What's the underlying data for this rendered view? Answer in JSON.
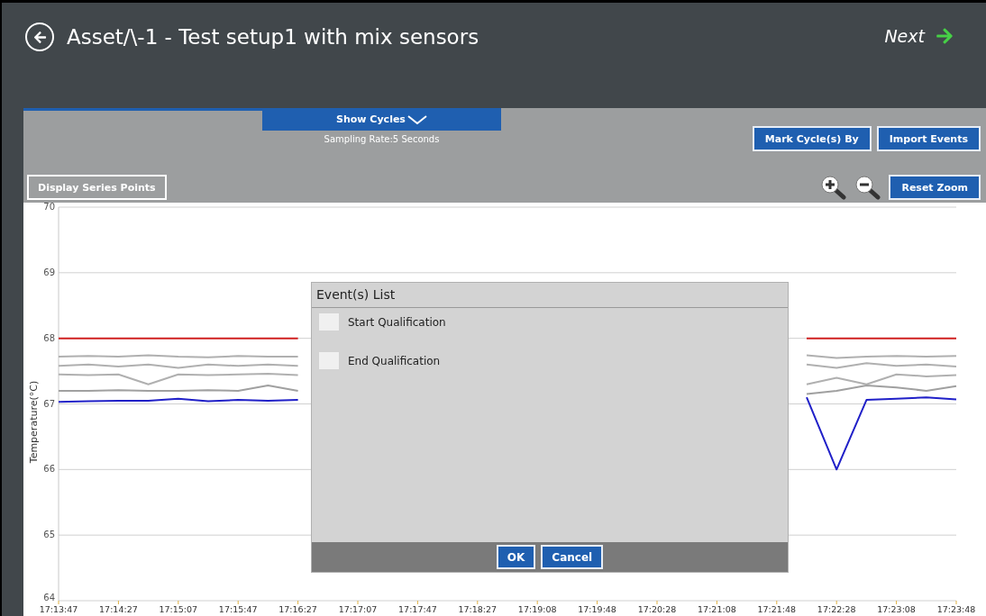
{
  "header": {
    "title": "Asset/\\-1 - Test setup1 with mix sensors",
    "next_label": "Next"
  },
  "toolbar": {
    "show_cycles": "Show Cycles",
    "sampling_rate": "Sampling Rate:5 Seconds",
    "buttons": [
      "Mark Cycle(s) By",
      "Import Events"
    ],
    "display_points": "Display Series Points",
    "reset_zoom": "Reset Zoom"
  },
  "chart": {
    "chart_data": {
      "type": "line",
      "ylabel": "Temperature(°C)",
      "categories": [
        "17:13:47",
        null,
        "17:14:27",
        null,
        "17:15:07",
        null,
        "17:15:47",
        null,
        "17:16:27",
        null,
        "17:17:07",
        null,
        "17:17:47",
        null,
        "17:18:27",
        null,
        "17:19:08",
        null,
        "17:19:48",
        null,
        "17:20:28",
        null,
        "17:21:08",
        null,
        "17:21:48",
        null,
        "17:22:28",
        null,
        "17:23:08",
        null,
        "17:23:48"
      ],
      "ylim": [
        64,
        70
      ],
      "grid": true,
      "yticks": [
        64,
        65,
        66,
        67,
        68,
        69,
        70
      ],
      "series": [
        {
          "color": "#d02020",
          "values": [
            68,
            68,
            68,
            68,
            68,
            68,
            68,
            68,
            68,
            null,
            null,
            null,
            null,
            null,
            null,
            null,
            null,
            null,
            null,
            null,
            null,
            null,
            null,
            null,
            null,
            68,
            68,
            68,
            68,
            68,
            68
          ]
        },
        {
          "color": "#b0b0b0",
          "values": [
            67.72,
            67.73,
            67.72,
            67.74,
            67.72,
            67.71,
            67.73,
            67.72,
            67.72,
            null,
            null,
            null,
            null,
            null,
            null,
            null,
            null,
            null,
            null,
            null,
            null,
            null,
            null,
            null,
            null,
            67.74,
            67.7,
            67.72,
            67.73,
            67.72,
            67.73
          ]
        },
        {
          "color": "#b0b0b0",
          "values": [
            67.58,
            67.6,
            67.57,
            67.6,
            67.55,
            67.6,
            67.58,
            67.6,
            67.58,
            null,
            null,
            null,
            null,
            null,
            null,
            null,
            null,
            null,
            null,
            null,
            null,
            null,
            null,
            null,
            null,
            67.6,
            67.55,
            67.62,
            67.58,
            67.6,
            67.57
          ]
        },
        {
          "color": "#b0b0b0",
          "values": [
            67.45,
            67.44,
            67.45,
            67.3,
            67.45,
            67.44,
            67.45,
            67.46,
            67.44,
            null,
            null,
            null,
            null,
            null,
            null,
            null,
            null,
            null,
            null,
            null,
            null,
            null,
            null,
            null,
            null,
            67.3,
            67.4,
            67.3,
            67.45,
            67.42,
            67.44
          ]
        },
        {
          "color": "#a0a0a0",
          "values": [
            67.2,
            67.2,
            67.21,
            67.2,
            67.2,
            67.21,
            67.2,
            67.28,
            67.2,
            null,
            null,
            null,
            null,
            null,
            null,
            null,
            null,
            null,
            null,
            null,
            null,
            null,
            null,
            null,
            null,
            67.15,
            67.2,
            67.28,
            67.25,
            67.2,
            67.27
          ]
        },
        {
          "color": "#2020c8",
          "values": [
            67.03,
            67.04,
            67.05,
            67.05,
            67.08,
            67.04,
            67.06,
            67.05,
            67.06,
            null,
            null,
            null,
            null,
            null,
            null,
            null,
            null,
            null,
            null,
            null,
            null,
            null,
            null,
            null,
            null,
            67.1,
            66.0,
            67.06,
            67.08,
            67.1,
            67.07
          ]
        }
      ]
    }
  },
  "dialog": {
    "title": "Event(s) List",
    "events": [
      {
        "label": "Start Qualification",
        "checked": false
      },
      {
        "label": "End Qualification",
        "checked": false
      }
    ],
    "buttons": [
      "OK",
      "Cancel"
    ]
  }
}
